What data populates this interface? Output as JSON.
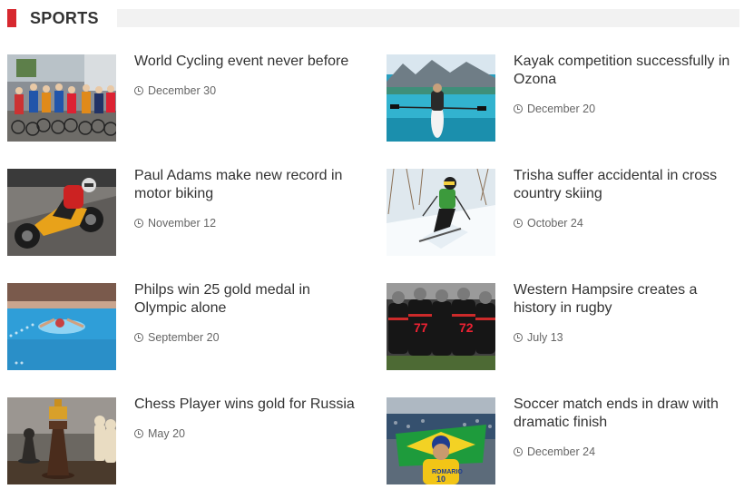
{
  "section": {
    "title": "SPORTS",
    "accent_color": "#d7282f"
  },
  "posts": [
    {
      "title": "World Cycling event never before",
      "date": "December 30",
      "image": "cycling-race"
    },
    {
      "title": "Kayak competition successfully in Ozona",
      "date": "December 20",
      "image": "kayak-lake"
    },
    {
      "title": "Paul Adams make new record in motor biking",
      "date": "November 12",
      "image": "motorbike-race"
    },
    {
      "title": "Trisha suffer accidental in cross country skiing",
      "date": "October 24",
      "image": "skier"
    },
    {
      "title": "Philps win 25 gold medal in Olympic alone",
      "date": "September 20",
      "image": "swimmer"
    },
    {
      "title": "Western Hampsire creates a history in rugby",
      "date": "July 13",
      "image": "rugby-team"
    },
    {
      "title": "Chess Player wins gold for Russia",
      "date": "May 20",
      "image": "chess-pieces"
    },
    {
      "title": "Soccer match ends in draw with dramatic finish",
      "date": "December 24",
      "image": "soccer-fan"
    }
  ]
}
